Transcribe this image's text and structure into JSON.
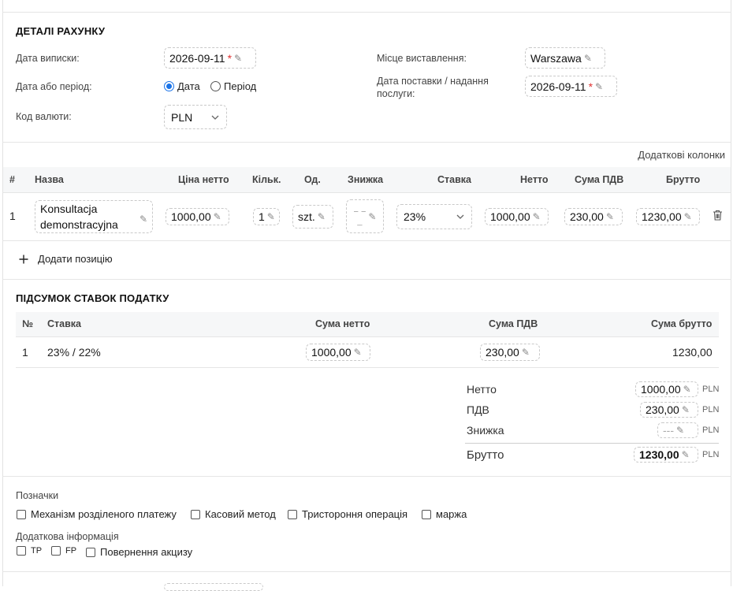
{
  "details": {
    "title": "ДЕТАЛІ РАХУНКУ",
    "issue_date_label": "Дата виписки:",
    "issue_date_value": "2026-09-11",
    "required_mark": "*",
    "place_label": "Місце виставлення:",
    "place_value": "Warszawa",
    "date_or_period_label": "Дата або період:",
    "radio_date": "Дата",
    "radio_period": "Період",
    "delivery_label": "Дата поставки / надання послуги:",
    "delivery_value": "2026-09-11",
    "currency_label": "Код валюти:",
    "currency_value": "PLN"
  },
  "items": {
    "extra_columns_link": "Додаткові колонки",
    "headers": [
      "#",
      "Назва",
      "Ціна нетто",
      "Кільк.",
      "Од.",
      "Знижка",
      "Ставка",
      "Нетто",
      "Сума ПДВ",
      "Брутто"
    ],
    "rows": [
      {
        "num": "1",
        "name_line1": "Konsultacja",
        "name_line2": "demonstracyjna",
        "price_net": "1000,00",
        "qty": "1",
        "unit": "szt.",
        "discount": "",
        "rate": "23%",
        "net": "1000,00",
        "vat": "230,00",
        "gross": "1230,00"
      }
    ],
    "add_position": "Додати позицію"
  },
  "tax_summary": {
    "title": "ПІДСУМОК СТАВОК ПОДАТКУ",
    "headers": [
      "№",
      "Ставка",
      "Сума нетто",
      "Сума ПДВ",
      "Сума брутто"
    ],
    "rows": [
      {
        "num": "1",
        "rate": "23% / 22%",
        "net": "1000,00",
        "vat": "230,00",
        "gross": "1230,00"
      }
    ]
  },
  "totals": {
    "net_label": "Нетто",
    "net_value": "1000,00",
    "vat_label": "ПДВ",
    "vat_value": "230,00",
    "discount_label": "Знижка",
    "discount_value": "---",
    "gross_label": "Брутто",
    "gross_value": "1230,00",
    "currency": "PLN"
  },
  "marks": {
    "title": "Позначки",
    "options": [
      "Механізм розділеного платежу",
      "Касовий метод",
      "Тристороння операція",
      "маржа"
    ],
    "extra_title": "Додаткова інформація",
    "extra_options": [
      "TP",
      "FP",
      "Повернення акцизу"
    ]
  },
  "icons": {
    "edit": "pencil-icon",
    "delete": "trash-icon",
    "add": "plus-icon",
    "dropdown": "chevron-down-icon"
  }
}
